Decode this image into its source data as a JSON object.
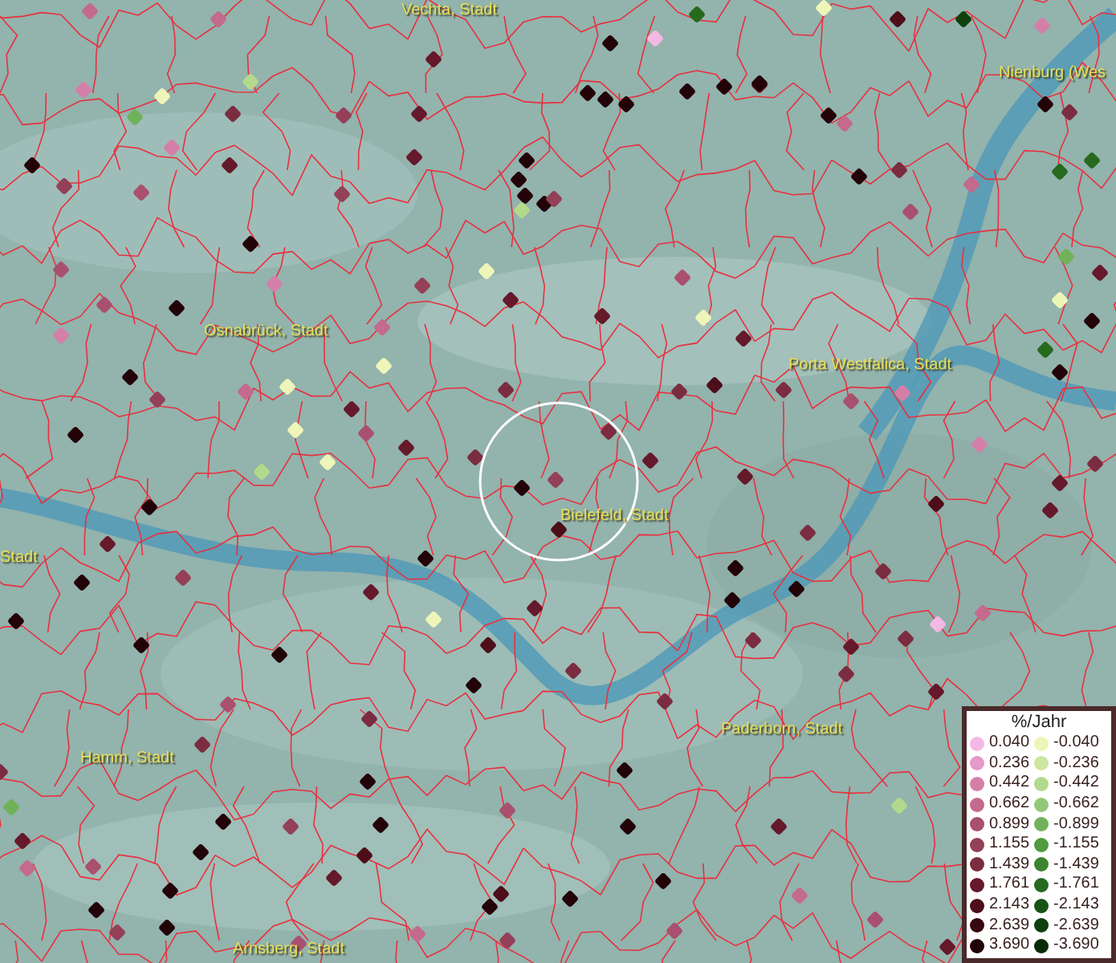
{
  "map": {
    "labels": [
      {
        "text": "Vechta, Stadt"
      },
      {
        "text": "Nienburg (Wes"
      },
      {
        "text": "Osnabrück, Stadt"
      },
      {
        "text": "Porta Westfalica, Stadt"
      },
      {
        "text": "Bielefeld, Stadt"
      },
      {
        "text": "Stadt"
      },
      {
        "text": "Hamm, Stadt"
      },
      {
        "text": "Paderborn, Stadt"
      },
      {
        "text": "Arnsberg, Stadt"
      }
    ]
  },
  "legend": {
    "title": "%/Jahr",
    "columns": [
      [
        {
          "label": "0.040",
          "color": "#f4b8e4"
        },
        {
          "label": "0.236",
          "color": "#e59ac8"
        },
        {
          "label": "0.442",
          "color": "#d47fa8"
        },
        {
          "label": "0.662",
          "color": "#c46a8c"
        },
        {
          "label": "0.899",
          "color": "#a9506e"
        },
        {
          "label": "1.155",
          "color": "#934058"
        },
        {
          "label": "1.439",
          "color": "#7c2c40"
        },
        {
          "label": "1.761",
          "color": "#65192a"
        },
        {
          "label": "2.143",
          "color": "#4d0e1a"
        },
        {
          "label": "2.639",
          "color": "#380710"
        },
        {
          "label": "3.690",
          "color": "#220308"
        }
      ],
      [
        {
          "label": "-0.040",
          "color": "#eef5b8"
        },
        {
          "label": "-0.236",
          "color": "#cde6a0"
        },
        {
          "label": "-0.442",
          "color": "#b3d98c"
        },
        {
          "label": "-0.662",
          "color": "#94c878"
        },
        {
          "label": "-0.899",
          "color": "#70b25a"
        },
        {
          "label": "-1.155",
          "color": "#519a40"
        },
        {
          "label": "-1.439",
          "color": "#3c842f"
        },
        {
          "label": "-1.761",
          "color": "#266a1e"
        },
        {
          "label": "-2.143",
          "color": "#175414"
        },
        {
          "label": "-2.639",
          "color": "#0e3f0c"
        },
        {
          "label": "-3.690",
          "color": "#072a07"
        }
      ]
    ]
  }
}
